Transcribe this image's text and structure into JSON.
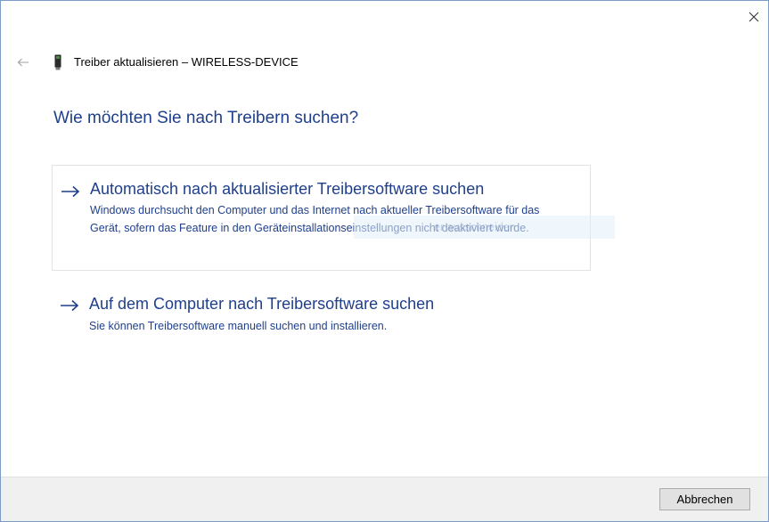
{
  "window": {
    "header_title": "Treiber aktualisieren – WIRELESS-DEVICE",
    "close_icon": "close-icon",
    "back_icon": "back-arrow-icon"
  },
  "main": {
    "heading": "Wie möchten Sie nach Treibern suchen?",
    "options": [
      {
        "title": "Automatisch nach aktualisierter Treibersoftware suchen",
        "description": "Windows durchsucht den Computer und das Internet nach aktueller Treibersoftware für das Gerät, sofern das Feature in den Geräteinstallationseinstellungen nicht deaktiviert wurde."
      },
      {
        "title": "Auf dem Computer nach Treibersoftware suchen",
        "description": "Sie können Treibersoftware manuell suchen und installieren."
      }
    ],
    "ghost_text": "er ausschneiden"
  },
  "footer": {
    "cancel_label": "Abbrechen"
  },
  "colors": {
    "accent": "#1f3f8c",
    "footer_bg": "#f0f0f0",
    "window_border": "#7a9cc6"
  }
}
